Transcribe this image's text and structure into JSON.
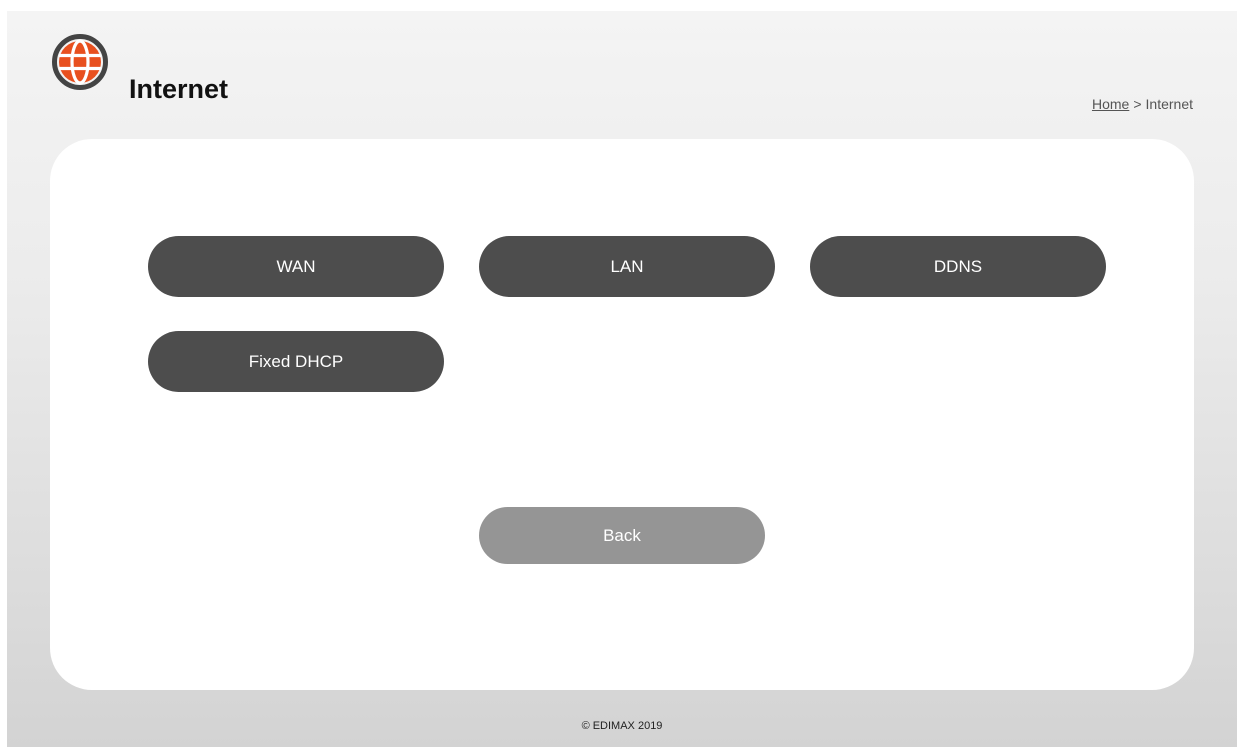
{
  "header": {
    "icon": "globe-icon",
    "icon_color": "#e8501f",
    "title": "Internet"
  },
  "breadcrumb": {
    "home": "Home",
    "separator": ">",
    "current": "Internet"
  },
  "menu": {
    "wan": "WAN",
    "lan": "LAN",
    "ddns": "DDNS",
    "fixed_dhcp": "Fixed DHCP"
  },
  "back_label": "Back",
  "footer": "© EDIMAX 2019",
  "colors": {
    "button": "#4d4d4d",
    "back_button": "#959595",
    "accent": "#e8501f"
  }
}
